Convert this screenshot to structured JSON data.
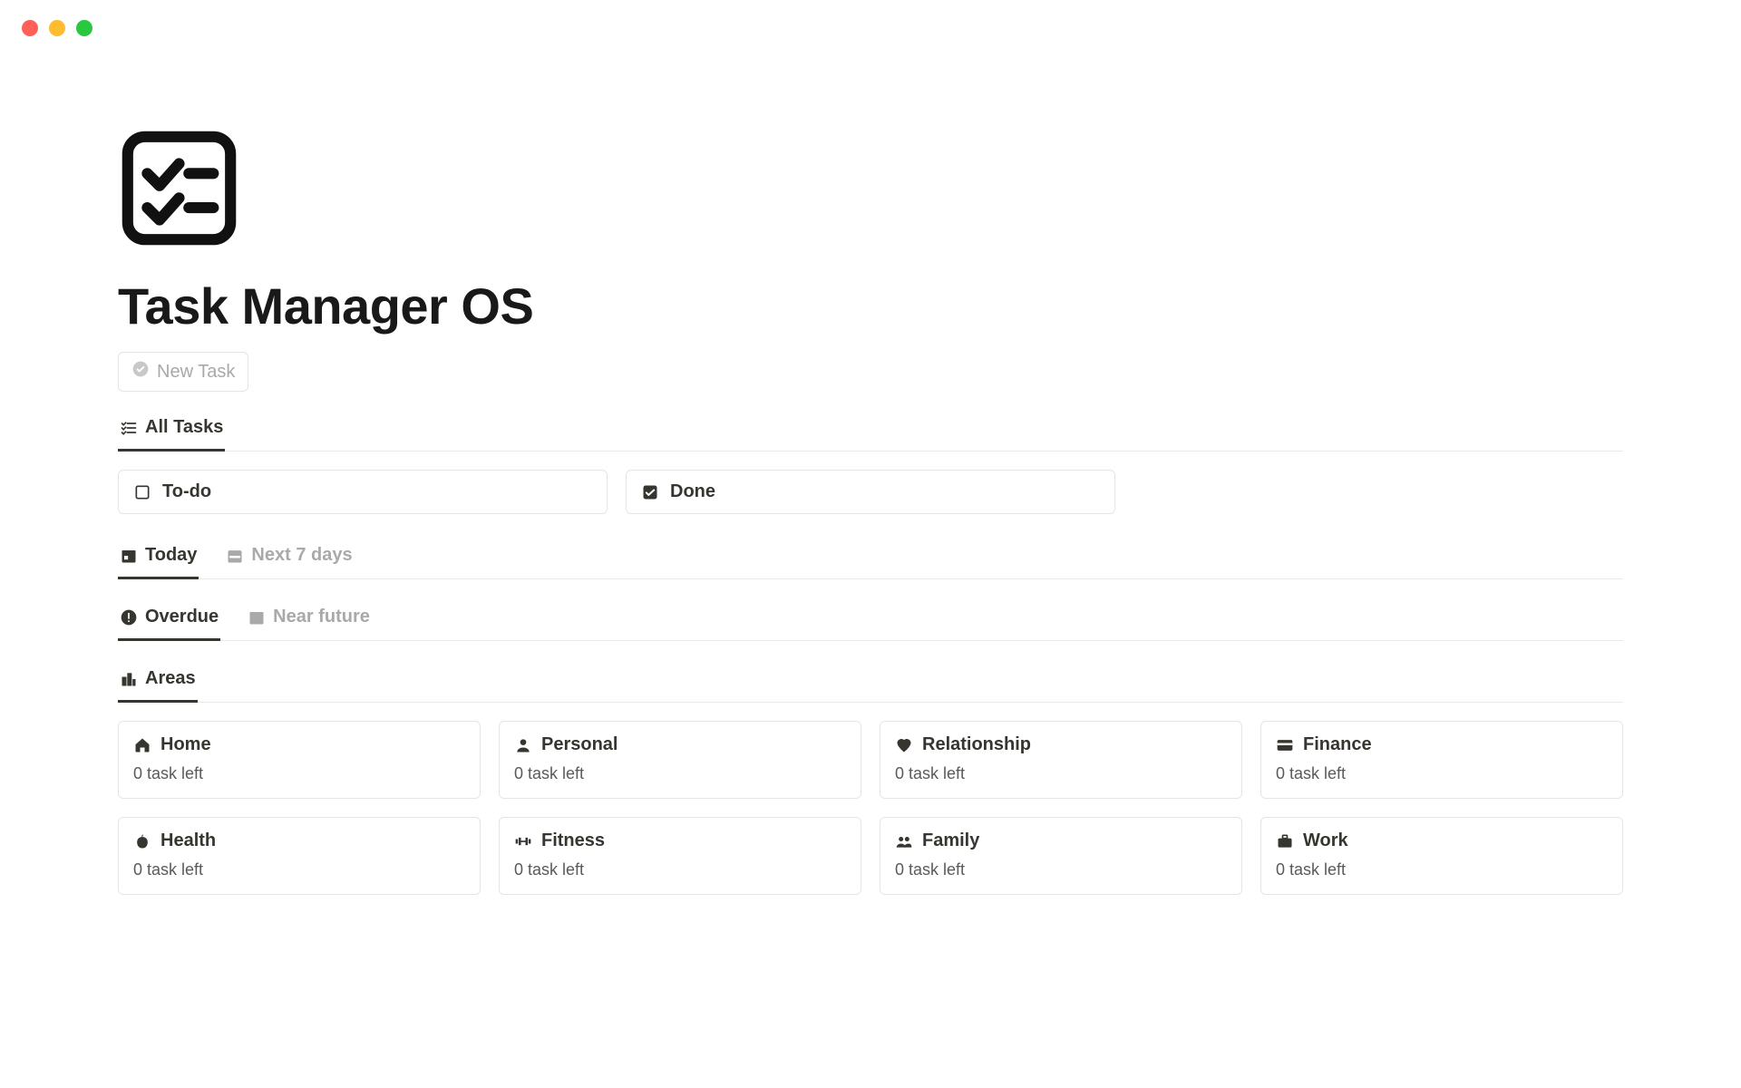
{
  "title": "Task Manager OS",
  "new_task_label": "New Task",
  "view_all_tasks": "All Tasks",
  "status": {
    "todo": "To-do",
    "done": "Done"
  },
  "time_tabs": {
    "today": "Today",
    "next7": "Next 7 days"
  },
  "horizon_tabs": {
    "overdue": "Overdue",
    "near_future": "Near future"
  },
  "areas_tab_label": "Areas",
  "task_left_text": "0 task left",
  "areas": [
    {
      "name": "Home",
      "icon": "home"
    },
    {
      "name": "Personal",
      "icon": "user"
    },
    {
      "name": "Relationship",
      "icon": "heart"
    },
    {
      "name": "Finance",
      "icon": "card"
    },
    {
      "name": "Health",
      "icon": "apple"
    },
    {
      "name": "Fitness",
      "icon": "dumbbell"
    },
    {
      "name": "Family",
      "icon": "users"
    },
    {
      "name": "Work",
      "icon": "briefcase"
    }
  ]
}
